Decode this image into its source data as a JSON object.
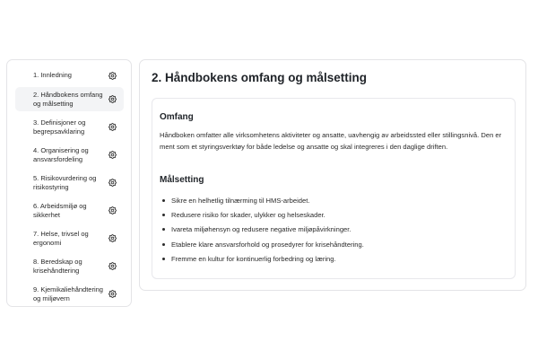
{
  "sidebar": {
    "items": [
      {
        "label": "1. Innledning",
        "icon": "gear-icon",
        "active": false
      },
      {
        "label": "2. Håndbokens omfang og målsetting",
        "icon": "gear-icon",
        "active": true
      },
      {
        "label": "3. Definisjoner og begrepsavklaring",
        "icon": "gear-icon",
        "active": false
      },
      {
        "label": "4. Organisering og ansvarsfordeling",
        "icon": "gear-icon",
        "active": false
      },
      {
        "label": "5. Risikovurdering og risikostyring",
        "icon": "gear-icon",
        "active": false
      },
      {
        "label": "6. Arbeidsmiljø og sikkerhet",
        "icon": "gear-icon",
        "active": false
      },
      {
        "label": "7. Helse, trivsel og ergonomi",
        "icon": "gear-icon",
        "active": false
      },
      {
        "label": "8. Beredskap og krisehåndtering",
        "icon": "gear-icon",
        "active": false
      },
      {
        "label": "9. Kjemikaliehåndtering og miljøvern",
        "icon": "gear-icon",
        "active": false
      }
    ]
  },
  "main": {
    "title": "2. Håndbokens omfang og målsetting",
    "scope": {
      "heading": "Omfang",
      "text": "Håndboken omfatter alle virksomhetens aktiviteter og ansatte, uavhengig av arbeidssted eller stillingsnivå. Den er ment som et styringsverktøy for både ledelse og ansatte og skal integreres i den daglige driften."
    },
    "goals": {
      "heading": "Målsetting",
      "items": [
        "Sikre en helhetlig tilnærming til HMS-arbeidet.",
        "Redusere risiko for skader, ulykker og helseskader.",
        "Ivareta miljøhensyn og redusere negative miljøpåvirkninger.",
        "Etablere klare ansvarsforhold og prosedyrer for krisehåndtering.",
        "Fremme en kultur for kontinuerlig forbedring og læring."
      ]
    }
  }
}
